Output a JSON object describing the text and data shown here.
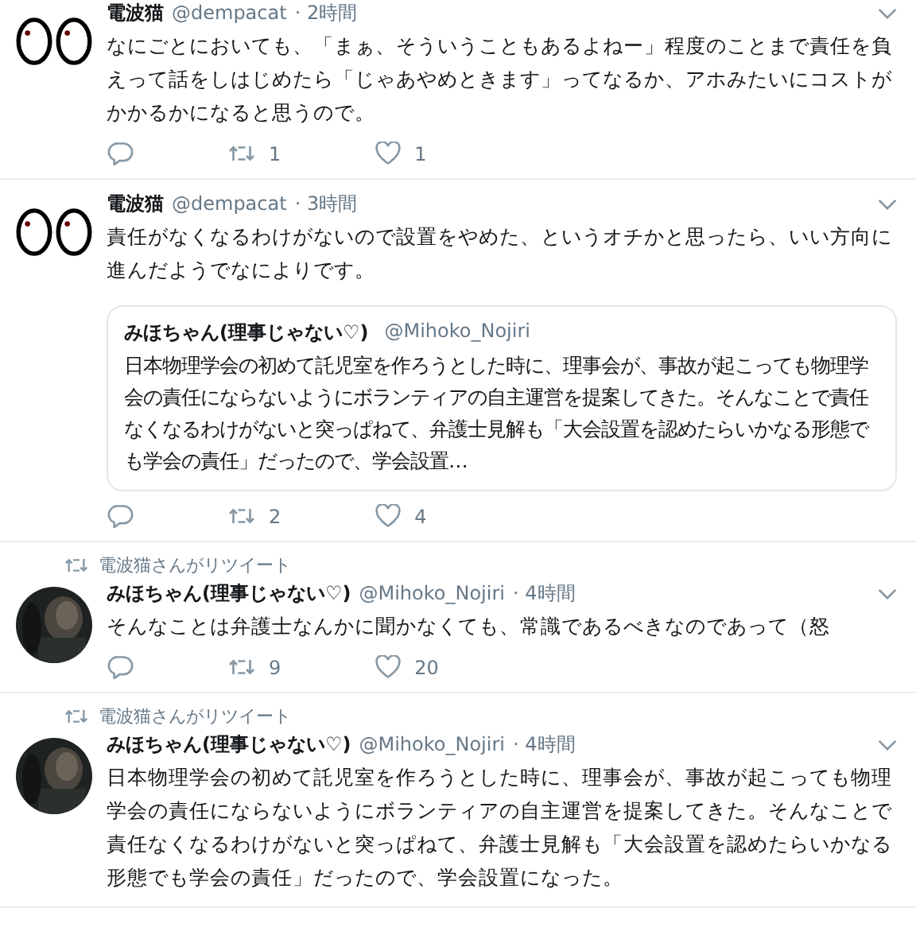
{
  "tweets": [
    {
      "avatar": {
        "kind": "eyes"
      },
      "name": "電波猫",
      "handle": "@dempacat",
      "time": "· 2時間",
      "text": "なにごとにおいても、「まぁ、そういうこともあるよねー」程度のことまで責任を負えって話をしはじめたら「じゃあやめときます」ってなるか、アホみたいにコストがかかるかになると思うので。",
      "actions": {
        "retweets": "1",
        "likes": "1"
      }
    },
    {
      "avatar": {
        "kind": "eyes"
      },
      "name": "電波猫",
      "handle": "@dempacat",
      "time": "· 3時間",
      "text": "責任がなくなるわけがないので設置をやめた、というオチかと思ったら、いい方向に進んだようでなによりです。",
      "quote": {
        "name": "みほちゃん(理事じゃない♡)",
        "handle": "@Mihoko_Nojiri",
        "text": "日本物理学会の初めて託児室を作ろうとした時に、理事会が、事故が起こっても物理学会の責任にならないようにボランティアの自主運営を提案してきた。そんなことで責任なくなるわけがないと突っぱねて、弁護士見解も「大会設置を認めたらいかなる形態でも学会の責任」だったので、学会設置…"
      },
      "actions": {
        "retweets": "2",
        "likes": "4"
      }
    },
    {
      "retweet_label": "電波猫さんがリツイート",
      "name": "みほちゃん(理事じゃない♡)",
      "handle": "@Mihoko_Nojiri",
      "time": "· 4時間",
      "text": "そんなことは弁護士なんかに聞かなくても、常識であるべきなのであって（怒",
      "actions": {
        "retweets": "9",
        "likes": "20"
      }
    },
    {
      "retweet_label": "電波猫さんがリツイート",
      "name": "みほちゃん(理事じゃない♡)",
      "handle": "@Mihoko_Nojiri",
      "time": "· 4時間",
      "text": "日本物理学会の初めて託児室を作ろうとした時に、理事会が、事故が起こっても物理学会の責任にならないようにボランティアの自主運営を提案してきた。そんなことで責任なくなるわけがないと突っぱねて、弁護士見解も「大会設置を認めたらいかなる形態でも学会の責任」だったので、学会設置になった。"
    }
  ]
}
